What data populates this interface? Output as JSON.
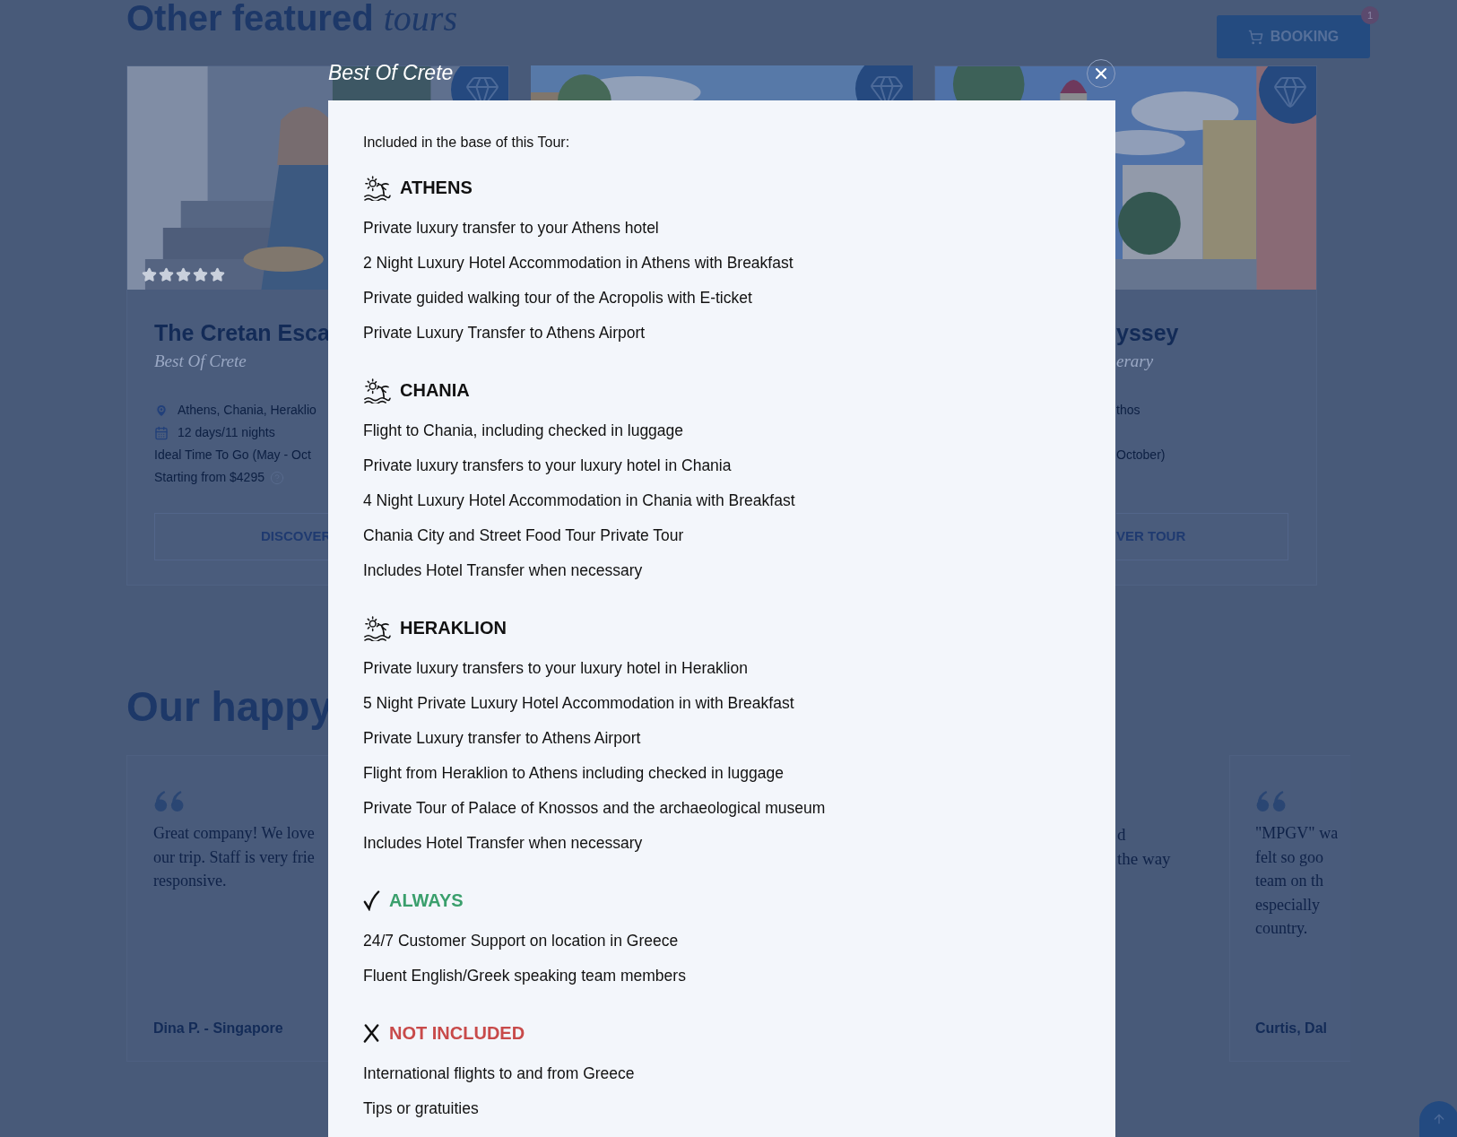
{
  "header": {
    "title": "Other featured",
    "title_italic": "tours"
  },
  "booking": {
    "label": "BOOKING",
    "badge": "1"
  },
  "tours": [
    {
      "kind": "left",
      "stars": 5,
      "title": "The Cretan Esca",
      "subtitle": "Best Of Crete",
      "details": [
        {
          "kind": "location",
          "text": "Athens, Chania, Heraklio"
        },
        {
          "kind": "duration",
          "text": "12 days/11 nights"
        },
        {
          "kind": "plain",
          "text": "Ideal Time To Go (May - Oct"
        },
        {
          "kind": "price",
          "text": "Starting from $4295"
        }
      ],
      "button": "DISCOVER"
    },
    {
      "kind": "covered"
    },
    {
      "kind": "right",
      "title": "yssey",
      "subtitle": "erary",
      "details": [
        {
          "kind": "plain",
          "text": "thos"
        },
        {
          "kind": "gap"
        },
        {
          "kind": "plain",
          "text": "October)"
        }
      ],
      "button": "VER TOUR"
    }
  ],
  "testimonials": {
    "heading": "Our happy",
    "reviews": [
      {
        "kind": "left",
        "quote": "Great company! We love\nour trip. Staff is very frie\nresponsive.",
        "author": "Dina P. - Singapore"
      },
      {
        "kind": "middle",
        "quote": "d\nthe way"
      },
      {
        "kind": "right",
        "quote": "\"MPGV\" wa\nfelt so goo\nteam on th\nespecially\ncountry.",
        "author": "Curtis, Dal"
      }
    ]
  },
  "modal": {
    "title": "Best Of Crete",
    "intro": "Included in the base of this Tour:",
    "sections": [
      {
        "kind": "destination",
        "heading": "ATHENS",
        "items": [
          "Private luxury transfer to your Athens hotel",
          "2 Night Luxury Hotel Accommodation in Athens with Breakfast",
          "Private guided walking tour of the Acropolis with E-ticket",
          "Private Luxury Transfer to Athens Airport"
        ]
      },
      {
        "kind": "destination",
        "heading": "CHANIA",
        "items": [
          "Flight to Chania, including checked in luggage",
          "Private luxury transfers to your luxury hotel in Chania",
          "4 Night Luxury Hotel Accommodation in Chania with Breakfast",
          "Chania City and Street Food Tour Private Tour",
          "Includes Hotel Transfer when necessary"
        ]
      },
      {
        "kind": "destination",
        "heading": "HERAKLION",
        "items": [
          "Private luxury transfers to your luxury hotel in Heraklion",
          "5 Night Private Luxury Hotel Accommodation in with Breakfast",
          "Private Luxury transfer to Athens Airport",
          "Flight from Heraklion to Athens including checked in luggage",
          "Private Tour of Palace of Knossos and the archaeological museum",
          "Includes Hotel Transfer when necessary"
        ]
      },
      {
        "kind": "always",
        "heading": "ALWAYS",
        "items": [
          "24/7 Customer Support on location in Greece",
          "Fluent English/Greek speaking team members"
        ]
      },
      {
        "kind": "excluded",
        "heading": "NOT INCLUDED",
        "items": [
          "International flights to and from Greece",
          "Tips or gratuities"
        ]
      }
    ]
  }
}
